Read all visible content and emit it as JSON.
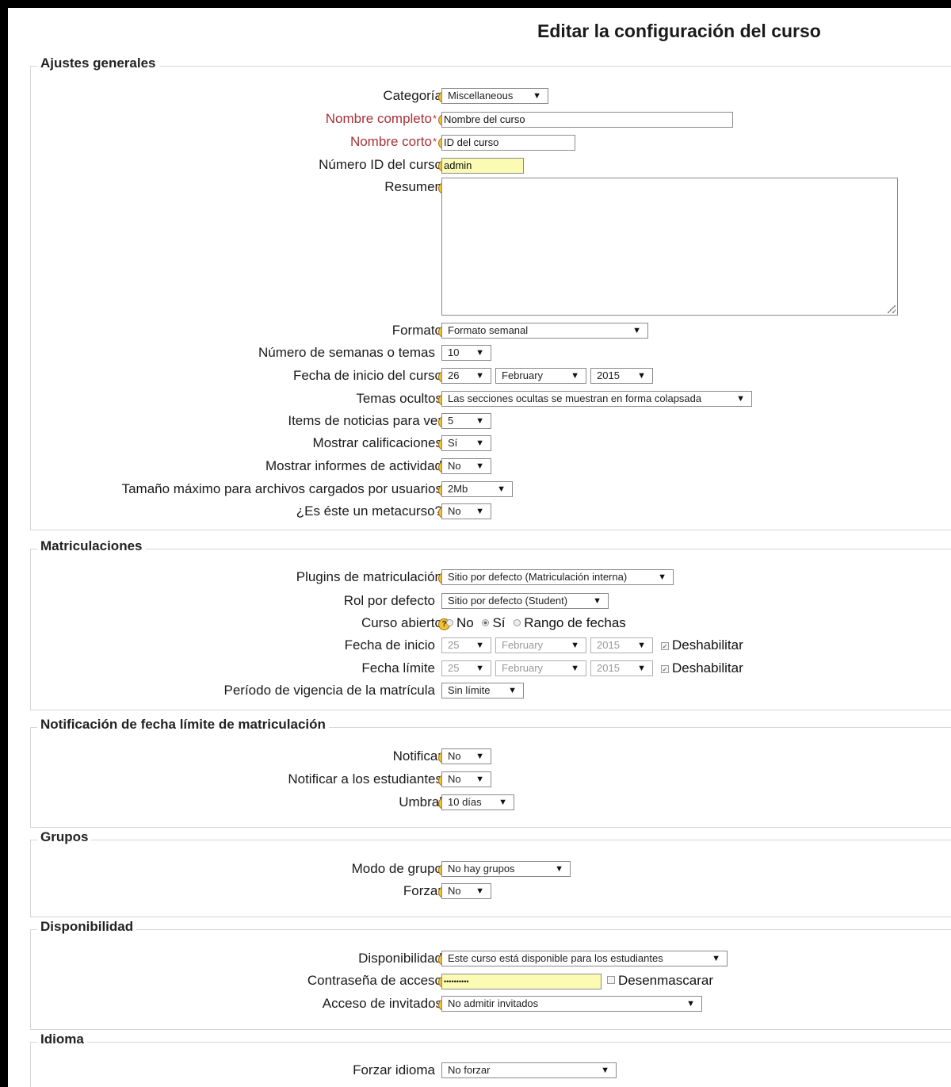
{
  "page_title": "Editar la configuración del curso",
  "icons": {
    "help": "help-icon",
    "dropdown": "dropdown-arrow-icon"
  },
  "colors": {
    "required_label": "#a83238",
    "highlight_input": "#fbfbb4",
    "help_icon": "#f2c230"
  },
  "sections": {
    "general": {
      "legend": "Ajustes generales",
      "categoria": {
        "label": "Categoría",
        "value": "Miscellaneous"
      },
      "nombre_completo": {
        "label": "Nombre completo",
        "value": "Nombre del curso"
      },
      "nombre_corto": {
        "label": "Nombre corto",
        "value": "ID del curso"
      },
      "numero_id": {
        "label": "Número ID del curso",
        "value": "admin"
      },
      "resumen": {
        "label": "Resumen",
        "value": ""
      },
      "formato": {
        "label": "Formato",
        "value": "Formato semanal"
      },
      "semanas": {
        "label": "Número de semanas o temas",
        "value": "10"
      },
      "fecha_inicio": {
        "label": "Fecha de inicio del curso",
        "day": "26",
        "month": "February",
        "year": "2015"
      },
      "temas_ocultos": {
        "label": "Temas ocultos",
        "value": "Las secciones ocultas se muestran en forma colapsada"
      },
      "items_noticias": {
        "label": "Items de noticias para ver",
        "value": "5"
      },
      "mostrar_calificaciones": {
        "label": "Mostrar calificaciones",
        "value": "Sí"
      },
      "mostrar_informes": {
        "label": "Mostrar informes de actividad",
        "value": "No"
      },
      "tamano_maximo": {
        "label": "Tamaño máximo para archivos cargados por usuarios",
        "value": "2Mb"
      },
      "metacurso": {
        "label": "¿Es éste un metacurso?",
        "value": "No"
      }
    },
    "matriculaciones": {
      "legend": "Matriculaciones",
      "plugins": {
        "label": "Plugins de matriculación",
        "value": "Sitio por defecto (Matriculación interna)"
      },
      "rol": {
        "label": "Rol por defecto",
        "value": "Sitio por defecto (Student)"
      },
      "curso_abierto": {
        "label": "Curso abierto",
        "options": [
          "No",
          "Sí",
          "Rango de fechas"
        ],
        "selected": "Sí"
      },
      "fecha_inicio": {
        "label": "Fecha de inicio",
        "day": "25",
        "month": "February",
        "year": "2015",
        "checkbox": "Deshabilitar"
      },
      "fecha_limite": {
        "label": "Fecha límite",
        "day": "25",
        "month": "February",
        "year": "2015",
        "checkbox": "Deshabilitar"
      },
      "periodo": {
        "label": "Período de vigencia de la matrícula",
        "value": "Sin límite"
      }
    },
    "notificacion": {
      "legend": "Notificación de fecha límite de matriculación",
      "notificar": {
        "label": "Notificar",
        "value": "No"
      },
      "notificar_estudiantes": {
        "label": "Notificar a los estudiantes",
        "value": "No"
      },
      "umbral": {
        "label": "Umbral",
        "value": "10 días"
      }
    },
    "grupos": {
      "legend": "Grupos",
      "modo": {
        "label": "Modo de grupo",
        "value": "No hay grupos"
      },
      "forzar": {
        "label": "Forzar",
        "value": "No"
      }
    },
    "disponibilidad": {
      "legend": "Disponibilidad",
      "disponibilidad": {
        "label": "Disponibilidad",
        "value": "Este curso está disponible para los estudiantes"
      },
      "contrasena": {
        "label": "Contraseña de acceso",
        "value": "••••••••••",
        "checkbox": "Desenmascarar"
      },
      "invitados": {
        "label": "Acceso de invitados",
        "value": "No admitir invitados"
      }
    },
    "idioma": {
      "legend": "Idioma",
      "forzar_idioma": {
        "label": "Forzar idioma",
        "value": "No forzar"
      }
    }
  }
}
